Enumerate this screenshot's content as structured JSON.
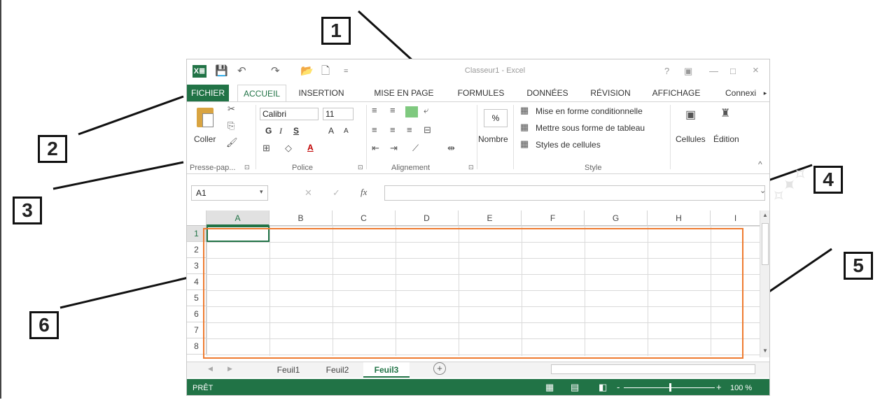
{
  "callouts": [
    "1",
    "2",
    "3",
    "4",
    "5",
    "6"
  ],
  "window": {
    "title": "Classeur1 - Excel",
    "help": "?",
    "ribbon_display": "▣",
    "minimize": "—",
    "maximize": "□",
    "close": "×"
  },
  "qat": {
    "app_icon": "X≣",
    "save": "💾",
    "undo": "↶",
    "redo": "↷",
    "open": "📂",
    "new": "🗋",
    "more": "="
  },
  "tabs": [
    "FICHIER",
    "ACCUEIL",
    "INSERTION",
    "MISE EN PAGE",
    "FORMULES",
    "DONNÉES",
    "RÉVISION",
    "AFFICHAGE",
    "Connexi"
  ],
  "ribbon": {
    "clipboard": {
      "paste": "Coller",
      "label": "Presse-pap...",
      "cut_icon": "✂",
      "copy_icon": "⎘",
      "format_painter_icon": "🖌"
    },
    "font": {
      "name": "Calibri",
      "size": "11",
      "bold": "G",
      "italic": "I",
      "underline": "S",
      "grow": "A",
      "shrink": "A",
      "font_color": "A",
      "label": "Police"
    },
    "alignment": {
      "label": "Alignement"
    },
    "number": {
      "percent": "%",
      "label": "Nombre"
    },
    "style": {
      "conditional": "Mise en forme conditionnelle",
      "table": "Mettre sous forme de tableau",
      "cell_styles": "Styles de cellules",
      "label": "Style"
    },
    "cells": {
      "label": "Cellules"
    },
    "editing": {
      "label": "Édition"
    },
    "dialog_launcher": "⊡",
    "collapse": "^"
  },
  "formula_bar": {
    "name_box": "A1",
    "cancel": "✕",
    "enter": "✓",
    "fx": "fx",
    "expand": "⌄"
  },
  "grid": {
    "columns": [
      "A",
      "B",
      "C",
      "D",
      "E",
      "F",
      "G",
      "H",
      "I"
    ],
    "rows": [
      "1",
      "2",
      "3",
      "4",
      "5",
      "6",
      "7",
      "8"
    ],
    "active_cell": "A1"
  },
  "sheets": {
    "tabs": [
      "Feuil1",
      "Feuil2",
      "Feuil3"
    ],
    "active": "Feuil3",
    "add": "+",
    "prev": "◀",
    "next": "▶"
  },
  "status": {
    "state": "PRÊT",
    "zoom": "100 %",
    "minus": "-",
    "plus": "+"
  },
  "colors": {
    "excel_green": "#217346",
    "highlight_orange": "#ee7b30"
  }
}
